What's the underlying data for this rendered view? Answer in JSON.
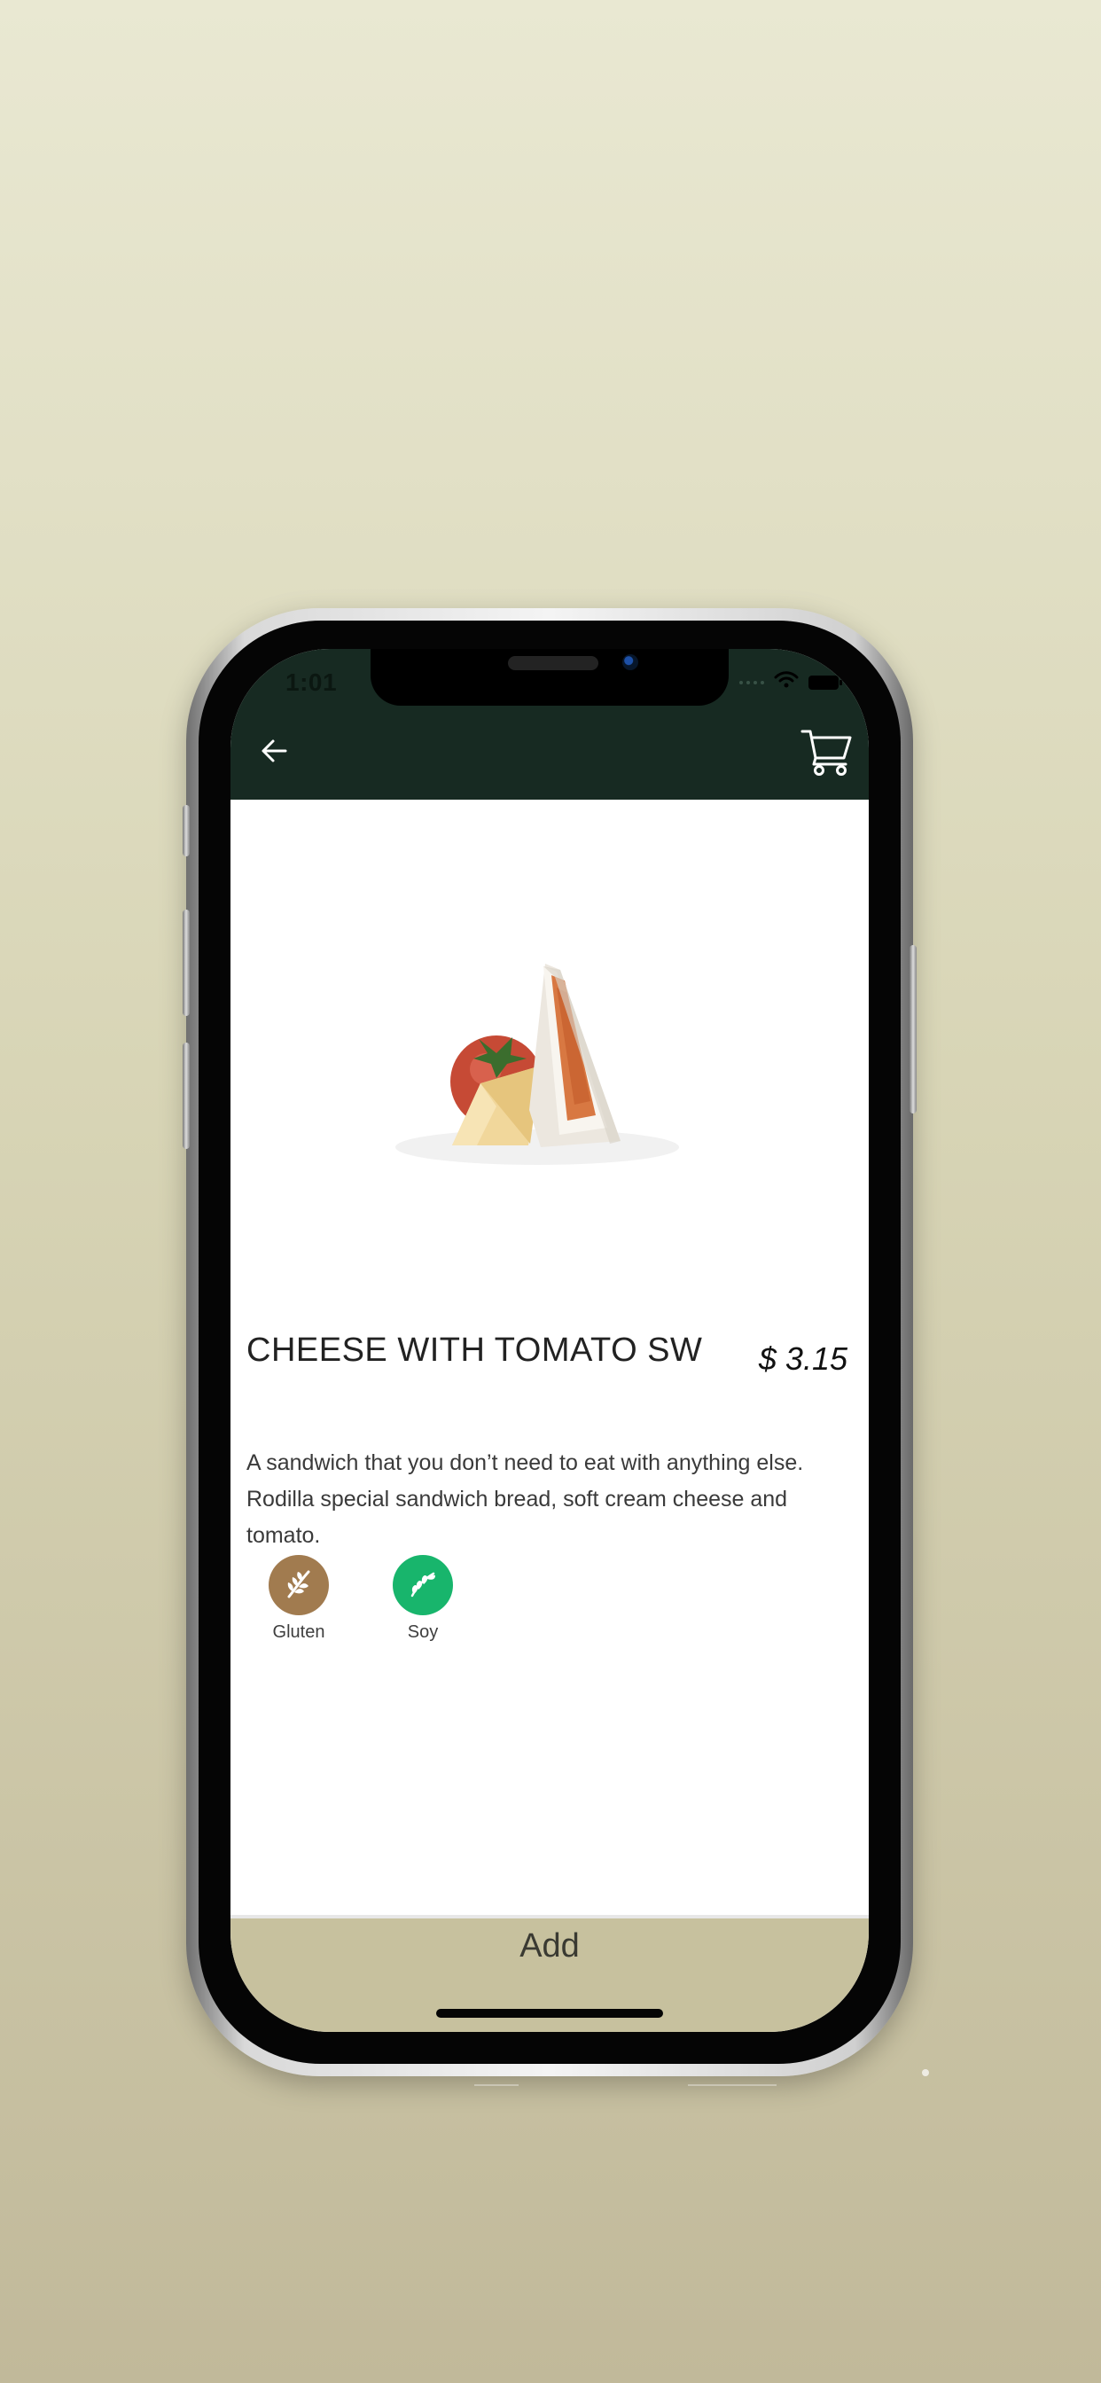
{
  "status": {
    "time": "1:01",
    "icons": [
      "signal-dots-icon",
      "wifi-icon",
      "battery-icon"
    ]
  },
  "navigation": {
    "back_icon": "arrow-left-icon",
    "cart_icon": "shopping-cart-icon"
  },
  "product": {
    "title": "CHEESE WITH TOMATO SW",
    "price": "$ 3.15",
    "description": "A sandwich that you don’t need to eat with anything else. Rodilla special sandwich bread, soft cream cheese and tomato."
  },
  "allergens": [
    {
      "label": "Gluten",
      "icon": "wheat-icon",
      "color": "#a17b4f"
    },
    {
      "label": "Soy",
      "icon": "soy-icon",
      "color": "#18b56c"
    }
  ],
  "actions": {
    "add_label": "Add"
  },
  "colors": {
    "background_top": "#e9e8d2",
    "background_bottom": "#c1b99a",
    "header": "#172a22",
    "bottom_bar": "#c7c19e"
  }
}
